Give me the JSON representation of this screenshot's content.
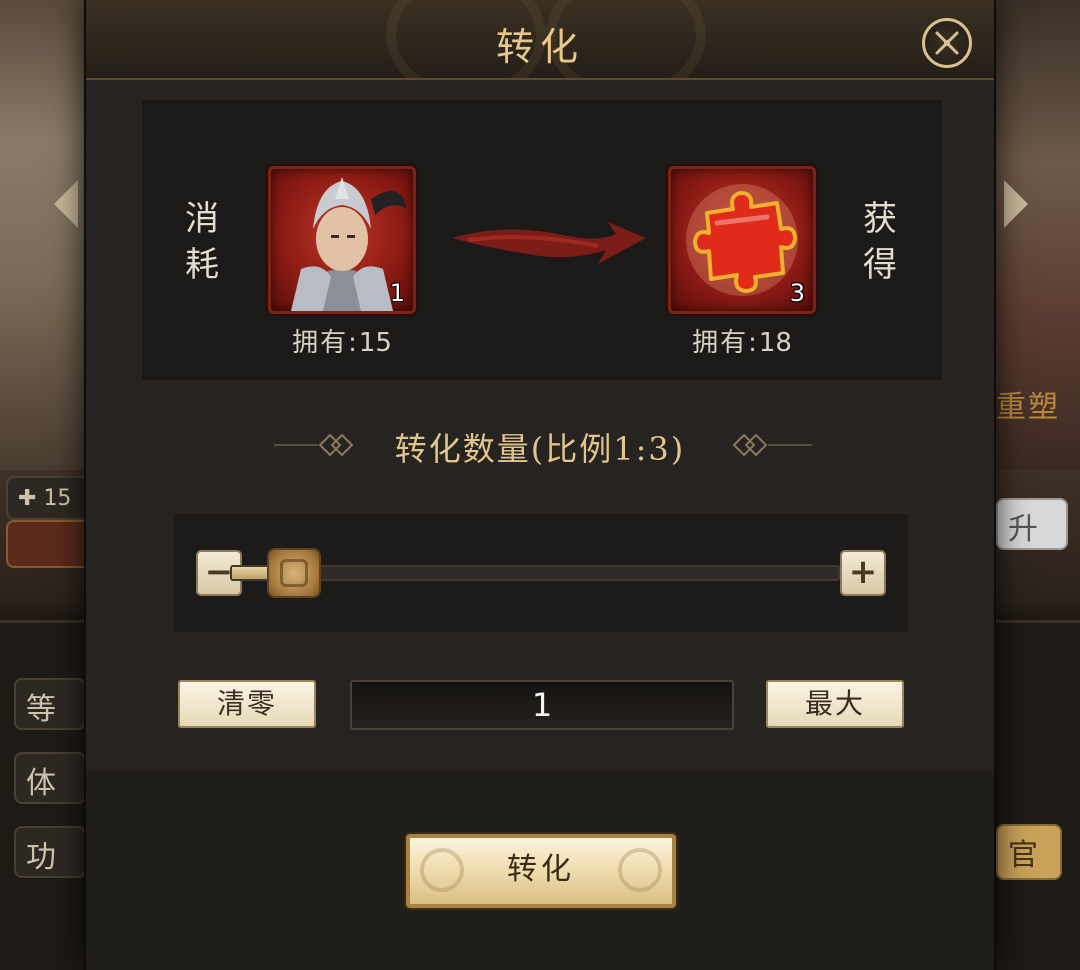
{
  "dialog": {
    "title": "转化",
    "close_icon": "close-crossed-swords-icon"
  },
  "exchange": {
    "consume_label": [
      "消",
      "耗"
    ],
    "obtain_label": [
      "获",
      "得"
    ],
    "consume_item": {
      "icon": "hero-portrait-icon",
      "count": "1",
      "owned_label": "拥有:",
      "owned_value": "15"
    },
    "obtain_item": {
      "icon": "red-puzzle-piece-icon",
      "count": "3",
      "owned_label": "拥有:",
      "owned_value": "18"
    },
    "arrow_icon": "red-brush-arrow-icon"
  },
  "ratio_title": "转化数量(比例1:3)",
  "slider": {
    "value_fraction": 0.06,
    "minus": "−",
    "plus": "+"
  },
  "controls": {
    "clear_label": "清零",
    "max_label": "最大",
    "quantity_value": "1"
  },
  "convert_button_label": "转化",
  "background": {
    "chip_count": "15",
    "chip_rebuild": "重塑",
    "chip_upgrade": "升",
    "chip_level": "等",
    "chip_stamina": "体",
    "chip_merit": "功",
    "chip_official": "官"
  },
  "colors": {
    "accent_gold": "#e0c68a",
    "item_frame_red": "#7a2418",
    "modal_bg": "#262320"
  }
}
